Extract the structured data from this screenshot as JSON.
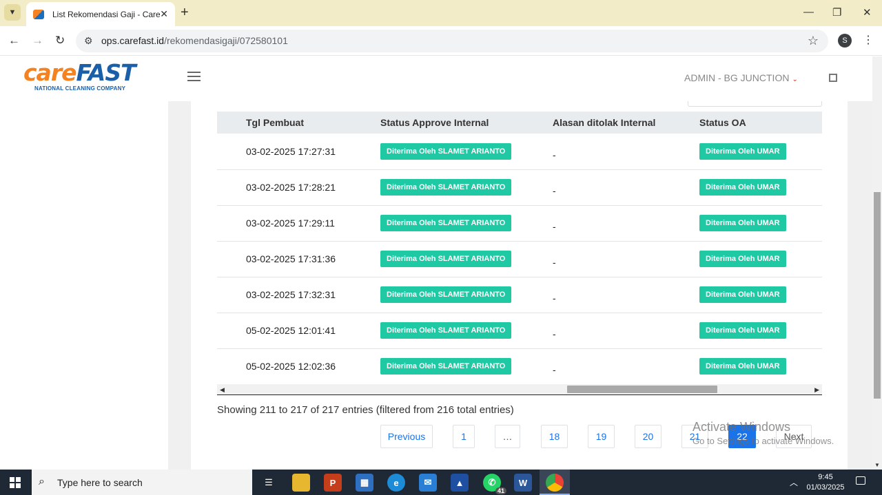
{
  "browser": {
    "tab_title": "List Rekomendasi Gaji - Carefast",
    "url_domain": "ops.carefast.id",
    "url_path": "/rekomendasigaji/072580101",
    "profile_initial": "S"
  },
  "header": {
    "logo_care": "care",
    "logo_fast": "FAST",
    "logo_sub": "NATIONAL CLEANING COMPANY",
    "user_label": "ADMIN - BG JUNCTION"
  },
  "table": {
    "columns": [
      "Tgl Pembuat",
      "Status Approve Internal",
      "Alasan ditolak Internal",
      "Status OA"
    ],
    "rows": [
      {
        "tgl": "03-02-2025 17:27:31",
        "status_internal": "Diterima Oleh SLAMET ARIANTO",
        "alasan": "-",
        "status_oa": "Diterima Oleh UMAR"
      },
      {
        "tgl": "03-02-2025 17:28:21",
        "status_internal": "Diterima Oleh SLAMET ARIANTO",
        "alasan": "-",
        "status_oa": "Diterima Oleh UMAR"
      },
      {
        "tgl": "03-02-2025 17:29:11",
        "status_internal": "Diterima Oleh SLAMET ARIANTO",
        "alasan": "-",
        "status_oa": "Diterima Oleh UMAR"
      },
      {
        "tgl": "03-02-2025 17:31:36",
        "status_internal": "Diterima Oleh SLAMET ARIANTO",
        "alasan": "-",
        "status_oa": "Diterima Oleh UMAR"
      },
      {
        "tgl": "03-02-2025 17:32:31",
        "status_internal": "Diterima Oleh SLAMET ARIANTO",
        "alasan": "-",
        "status_oa": "Diterima Oleh UMAR"
      },
      {
        "tgl": "05-02-2025 12:01:41",
        "status_internal": "Diterima Oleh SLAMET ARIANTO",
        "alasan": "-",
        "status_oa": "Diterima Oleh UMAR"
      },
      {
        "tgl": "05-02-2025 12:02:36",
        "status_internal": "Diterima Oleh SLAMET ARIANTO",
        "alasan": "-",
        "status_oa": "Diterima Oleh UMAR"
      }
    ]
  },
  "info": "Showing 211 to 217 of 217 entries (filtered from 216 total entries)",
  "pagination": {
    "previous": "Previous",
    "pages": [
      "1",
      "…",
      "18",
      "19",
      "20",
      "21",
      "22"
    ],
    "current": "22",
    "next": "Next"
  },
  "watermark": {
    "line1": "Activate Windows",
    "line2": "Go to Settings to activate Windows."
  },
  "taskbar": {
    "search_placeholder": "Type here to search",
    "whatsapp_badge": "41",
    "time": "9:45",
    "date": "01/03/2025"
  },
  "colors": {
    "badge_green": "#1ec9a4",
    "link_blue": "#1a73e8",
    "brand_orange": "#f58220",
    "brand_blue": "#1b5fa8"
  }
}
